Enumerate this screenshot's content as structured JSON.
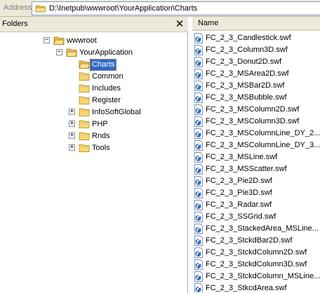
{
  "address": {
    "label": "Address",
    "path": "D:\\Inetpub\\wwwroot\\YourApplication\\Charts"
  },
  "folders_pane": {
    "title": "Folders",
    "close_glyph": "✕",
    "tree": [
      {
        "label": "wwwroot",
        "toggle": "−",
        "level": 0,
        "icon": "folder-open-icon"
      },
      {
        "label": "YourApplication",
        "toggle": "−",
        "level": 1,
        "icon": "folder-open-icon"
      },
      {
        "label": "Charts",
        "toggle": "",
        "level": 2,
        "icon": "folder-open-icon",
        "selected": true
      },
      {
        "label": "Common",
        "toggle": "",
        "level": 2,
        "icon": "folder-icon"
      },
      {
        "label": "Includes",
        "toggle": "",
        "level": 2,
        "icon": "folder-icon"
      },
      {
        "label": "Register",
        "toggle": "",
        "level": 2,
        "icon": "folder-icon"
      },
      {
        "label": "InfoSoftGlobal",
        "toggle": "+",
        "level": 2,
        "icon": "folder-icon"
      },
      {
        "label": "PHP",
        "toggle": "+",
        "level": 2,
        "icon": "folder-icon"
      },
      {
        "label": "Rnds",
        "toggle": "+",
        "level": 2,
        "icon": "folder-icon"
      },
      {
        "label": "Tools",
        "toggle": "+",
        "level": 2,
        "icon": "folder-icon"
      }
    ]
  },
  "files_pane": {
    "column_name": "Name",
    "files": [
      "FC_2_3_Candlestick.swf",
      "FC_2_3_Column3D.swf",
      "FC_2_3_Donut2D.swf",
      "FC_2_3_MSArea2D.swf",
      "FC_2_3_MSBar2D.swf",
      "FC_2_3_MSBubble.swf",
      "FC_2_3_MSColumn2D.swf",
      "FC_2_3_MSColumn3D.swf",
      "FC_2_3_MSColumnLine_DY_2...",
      "FC_2_3_MSColumnLine_DY_3...",
      "FC_2_3_MSLine.swf",
      "FC_2_3_MSScatter.swf",
      "FC_2_3_Pie2D.swf",
      "FC_2_3_Pie3D.swf",
      "FC_2_3_Radar.swf",
      "FC_2_3_SSGrid.swf",
      "FC_2_3_StackedArea_MSLine...",
      "FC_2_3_StckdBar2D.swf",
      "FC_2_3_StckdColumn2D.swf",
      "FC_2_3_StckdColumn3D.swf",
      "FC_2_3_StckdColumn_MSLine...",
      "FC_2_3_StkcdArea.swf"
    ]
  },
  "colors": {
    "selection": "#316ac5",
    "chrome": "#ece9d8",
    "folder": "#f5d776"
  }
}
